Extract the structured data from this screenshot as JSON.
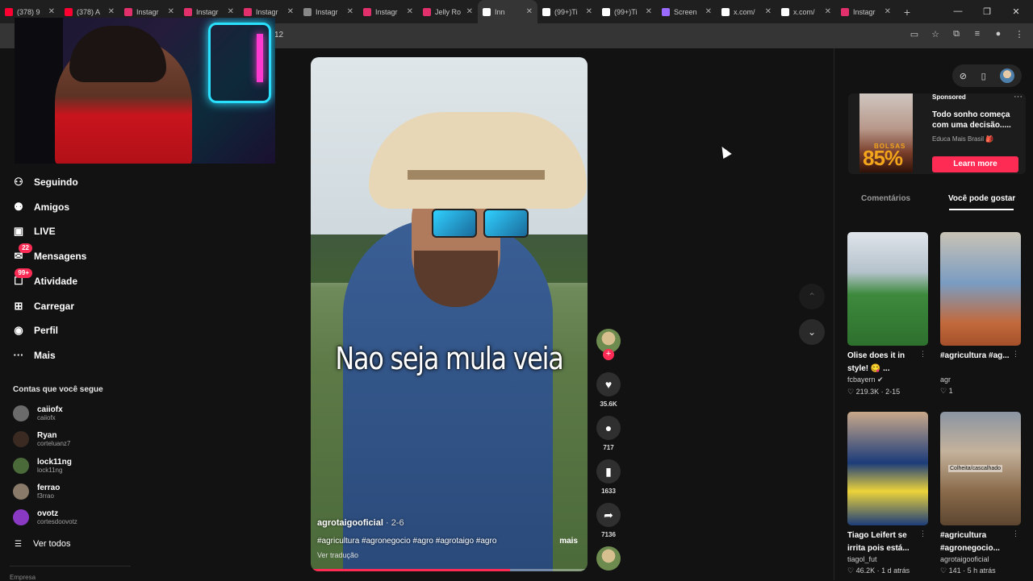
{
  "browser": {
    "tabs": [
      {
        "label": "(378) 9",
        "color": "#ff0033"
      },
      {
        "label": "(378) A",
        "color": "#ff0033"
      },
      {
        "label": "Instagr",
        "color": "#e1306c"
      },
      {
        "label": "Instagr",
        "color": "#e1306c"
      },
      {
        "label": "Instagr",
        "color": "#e1306c"
      },
      {
        "label": "Instagr",
        "color": "#888888"
      },
      {
        "label": "Instagr",
        "color": "#e1306c"
      },
      {
        "label": "Jelly Ro",
        "color": "#e1306c"
      },
      {
        "label": "Inn",
        "color": "#ffffff"
      },
      {
        "label": "(99+)Ti",
        "color": "#ffffff"
      },
      {
        "label": "(99+)Ti",
        "color": "#ffffff"
      },
      {
        "label": "Screen",
        "color": "#9b6bff"
      },
      {
        "label": "x.com/",
        "color": "#ffffff"
      },
      {
        "label": "x.com/",
        "color": "#ffffff"
      },
      {
        "label": "Instagr",
        "color": "#e1306c"
      }
    ],
    "active_tab_index": 8,
    "url_fragment": "12"
  },
  "sidebar": {
    "items": [
      {
        "label": "Seguindo",
        "icon": "following-icon"
      },
      {
        "label": "Amigos",
        "icon": "friends-icon"
      },
      {
        "label": "LIVE",
        "icon": "live-icon"
      },
      {
        "label": "Mensagens",
        "icon": "messages-icon",
        "badge": "22"
      },
      {
        "label": "Atividade",
        "icon": "activity-icon",
        "badge": "99+"
      },
      {
        "label": "Carregar",
        "icon": "upload-icon"
      },
      {
        "label": "Perfil",
        "icon": "profile-icon"
      },
      {
        "label": "Mais",
        "icon": "more-icon"
      }
    ],
    "section_title": "Contas que você segue",
    "accounts": [
      {
        "name": "caiiofx",
        "user": "caiiofx",
        "color": "#6b6b6b"
      },
      {
        "name": "Ryan",
        "user": "corteluanz7",
        "color": "#3a2a22"
      },
      {
        "name": "lock11ng",
        "user": "lock11ng",
        "color": "#4a6a3a"
      },
      {
        "name": "ferrao",
        "user": "f3rrao",
        "color": "#8a7a6a"
      },
      {
        "name": "ovotz",
        "user": "cortesdoovotz",
        "color": "#8a3ac2"
      }
    ],
    "see_all": "Ver todos",
    "footer": "Empresa"
  },
  "video": {
    "caption": "Nao seja mula veia",
    "author": "agrotaigooficial",
    "date": "· 2-6",
    "hashtags": "#agricultura #agronegocio #agro #agrotaigo #agro",
    "more": "mais",
    "translate": "Ver tradução",
    "progress": 0.72
  },
  "actions": {
    "likes": "35.6K",
    "comments": "717",
    "saves": "1633",
    "shares": "7136"
  },
  "right_panel": {
    "ad": {
      "sponsored": "Sponsored",
      "title": "Todo sonho começa com uma decisão.....",
      "source": "Educa Mais Brasil 🎒",
      "cta": "Learn more",
      "img_word": "BOLSAS",
      "img_pct": "85%"
    },
    "tabs": [
      "Comentários",
      "Você pode gostar"
    ],
    "selected_tab": 1,
    "cards": [
      {
        "title": "Olise does it in style! 😋 ...",
        "user": "fcbayern ✔",
        "stats": "♡ 219.3K · 2-15"
      },
      {
        "title": "#agricultura #ag...",
        "user": "agr",
        "stats": "♡ 1"
      },
      {
        "title": "Tiago Leifert se irrita pois está...",
        "user": "tiagol_fut",
        "stats": "♡ 46.2K · 1 d atrás"
      },
      {
        "title": "#agricultura #agronegocio...",
        "user": "agrotaigooficial",
        "stats": "♡ 141 · 5 h atrás",
        "overlay": "Colheita/cascalhado"
      }
    ]
  }
}
